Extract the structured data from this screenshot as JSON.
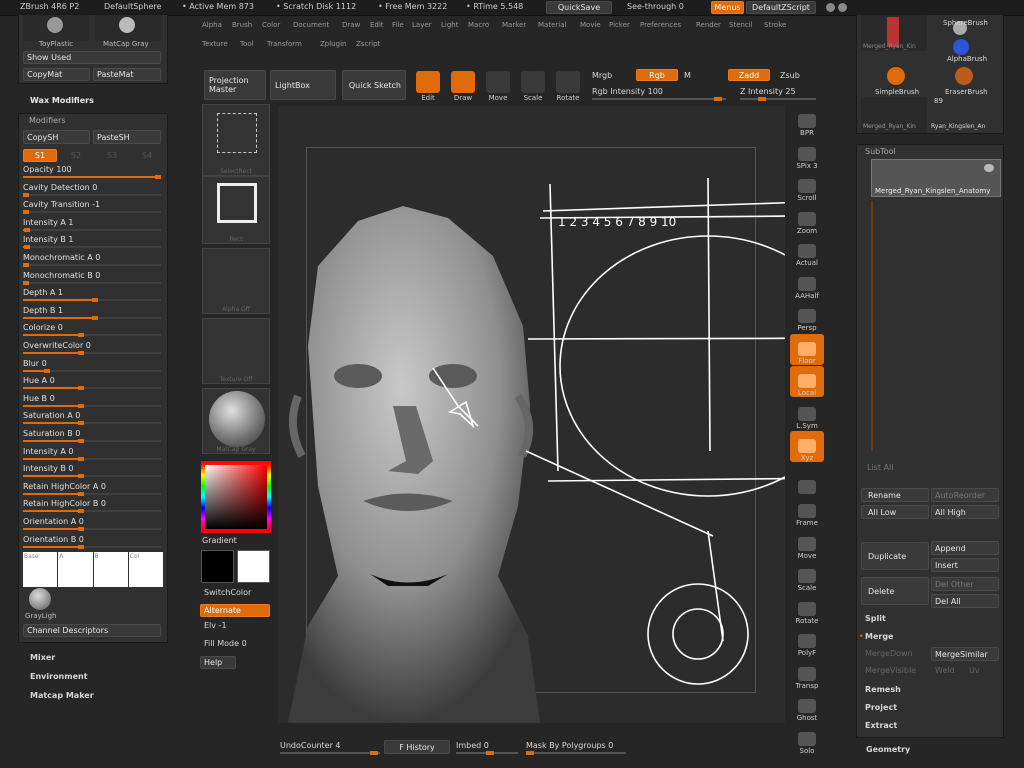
{
  "topbar": {
    "app": "ZBrush 4R6 P2",
    "doc": "DefaultSphere",
    "active_mem": "• Active Mem 873",
    "scratch": "• Scratch Disk 1112",
    "free_mem": "• Free Mem 3222",
    "rtime": "• RTime 5.548",
    "quicksave": "QuickSave",
    "see_through": "See-through 0",
    "menus": "Menus",
    "script": "DefaultZScript"
  },
  "mainmenu": [
    "Alpha",
    "Brush",
    "Color",
    "Document",
    "Draw",
    "Edit",
    "File",
    "Layer",
    "Light",
    "Macro",
    "Marker",
    "Material",
    "Movie",
    "Picker",
    "Preferences",
    "Render",
    "Stencil",
    "Stroke",
    "Texture",
    "Tool",
    "Transform",
    "Zplugin",
    "Zscript"
  ],
  "left_top": {
    "mat1": "ToyPlastic",
    "mat2": "MatCap Gray",
    "show_used": "Show Used",
    "copy_mat": "CopyMat",
    "paste_mat": "PasteMat"
  },
  "wax": {
    "title": "Wax Modifiers",
    "modifiers": "Modifiers",
    "copy_sh": "CopySH",
    "paste_sh": "PasteSH",
    "s1": "S1",
    "s2": "S2",
    "s3": "S3",
    "s4": "S4"
  },
  "mod_rows": [
    {
      "label": "Opacity 100",
      "fill": 1.0
    },
    {
      "label": "Cavity Detection 0",
      "fill": 0
    },
    {
      "label": "Cavity Transition -1",
      "fill": 0
    },
    {
      "label": "Intensity A 1",
      "fill": 0.01
    },
    {
      "label": "Intensity B 1",
      "fill": 0.01
    },
    {
      "label": "Monochromatic A 0",
      "fill": 0
    },
    {
      "label": "Monochromatic B 0",
      "fill": 0
    },
    {
      "label": "Depth A 1",
      "fill": 0.5
    },
    {
      "label": "Depth B 1",
      "fill": 0.5
    },
    {
      "label": "Colorize 0",
      "fill": 0.4
    },
    {
      "label": "OverwriteColor 0",
      "fill": 0.4
    },
    {
      "label": "Blur 0",
      "fill": 0.15
    },
    {
      "label": "Hue A 0",
      "fill": 0.4
    },
    {
      "label": "Hue B 0",
      "fill": 0.4
    },
    {
      "label": "Saturation A 0",
      "fill": 0.4
    },
    {
      "label": "Saturation B 0",
      "fill": 0.4
    },
    {
      "label": "Intensity A 0",
      "fill": 0.4
    },
    {
      "label": "Intensity B 0",
      "fill": 0.4
    },
    {
      "label": "Retain HighColor A 0",
      "fill": 0.4
    },
    {
      "label": "Retain HighColor B 0",
      "fill": 0.4
    },
    {
      "label": "Orientation A 0",
      "fill": 0.4
    },
    {
      "label": "Orientation B 0",
      "fill": 0.4
    }
  ],
  "swatches": [
    "Base",
    "A",
    "B",
    "Col"
  ],
  "gray_light": "GrayLigh",
  "channel_desc": "Channel Descriptors",
  "left_bottom": [
    "Mixer",
    "Environment",
    "Matcap Maker"
  ],
  "shelf": {
    "projection_master": "Projection Master",
    "lightbox": "LightBox",
    "quick_sketch": "Quick Sketch",
    "edit": "Edit",
    "draw": "Draw",
    "move": "Move",
    "scale": "Scale",
    "rotate": "Rotate",
    "mrgb": "Mrgb",
    "rgb": "Rgb",
    "m": "M",
    "rgb_intensity": "Rgb Intensity 100",
    "zadd": "Zadd",
    "zsub": "Zsub",
    "z_intensity": "Z Intensity 25"
  },
  "tray": {
    "select_rect": "SelectRect",
    "rect": "Rect",
    "alpha_off": "Alpha Off",
    "texture_off": "Texture Off",
    "matcap": "MatCap Gray",
    "gradient": "Gradient",
    "switch_color": "SwitchColor",
    "alternate": "Alternate",
    "elv": "Elv -1",
    "fill_mode": "Fill Mode 0",
    "help": "Help"
  },
  "right_tools": [
    "BPR",
    "SPix 3",
    "Scroll",
    "Zoom",
    "Actual",
    "AAHalf",
    "Persp",
    "Floor",
    "Local",
    "L.Sym",
    "Xyz",
    "",
    "Frame",
    "Move",
    "Scale",
    "Rotate",
    "PolyF",
    "Transp",
    "Ghost",
    "Solo"
  ],
  "tool_thumbs": [
    "Merged_Ryan_Kin",
    "SphereBrush",
    "AlphaBrush",
    "SimpleBrush",
    "EraserBrush",
    "89",
    "Merged_Ryan_Kin",
    "Ryan_Kingslen_An"
  ],
  "subtool": {
    "title": "SubTool",
    "item": "Merged_Ryan_Kingslen_Anatomy",
    "list_all": "List All",
    "rename": "Rename",
    "auto_reorder": "AutoReorder",
    "all_low": "All Low",
    "all_high": "All High",
    "duplicate": "Duplicate",
    "append": "Append",
    "insert": "Insert",
    "delete": "Delete",
    "del_other": "Del Other",
    "del_all": "Del All",
    "split": "Split",
    "merge": "Merge",
    "merge_down": "MergeDown",
    "merge_similar": "MergeSimilar",
    "merge_visible": "MergeVisible",
    "weld": "Weld",
    "uv": "Uv",
    "remesh": "Remesh",
    "project": "Project",
    "extract": "Extract",
    "geometry": "Geometry"
  },
  "canvas_sketch_text": "1 2 3 4 5 6 7 8 9 10",
  "bottom": {
    "undo": "UndoCounter 4",
    "history": "F History",
    "imbed": "Imbed 0",
    "mask_polygroups": "Mask By Polygroups 0"
  },
  "colors": {
    "accent": "#e06b0a",
    "panel": "#303030",
    "bg": "#262626"
  }
}
